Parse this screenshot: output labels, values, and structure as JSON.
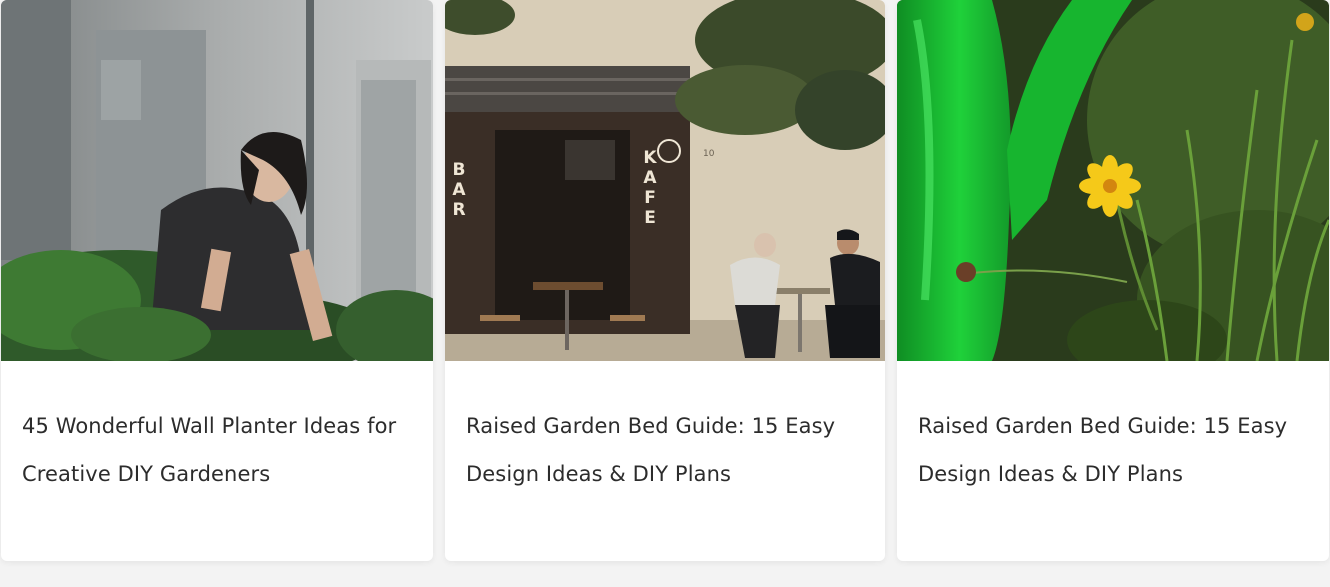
{
  "cards": [
    {
      "title": "45 Wonderful Wall Planter Ideas for Creative DIY Gardeners",
      "image_subject": "woman-tending-plants-photo"
    },
    {
      "title": "Raised Garden Bed Guide: 15 Easy Design Ideas & DIY Plans",
      "image_subject": "cafe-storefront-photo",
      "image_text": {
        "sign_left": "BAR",
        "sign_right": "KAFE",
        "door_number": "10"
      }
    },
    {
      "title": "Raised Garden Bed Guide: 15 Easy Design Ideas & DIY Plans",
      "image_subject": "watering-can-flower-photo"
    }
  ],
  "colors": {
    "page_background": "#f3f3f3",
    "card_background": "#ffffff",
    "title_text": "#2c2c2c"
  }
}
